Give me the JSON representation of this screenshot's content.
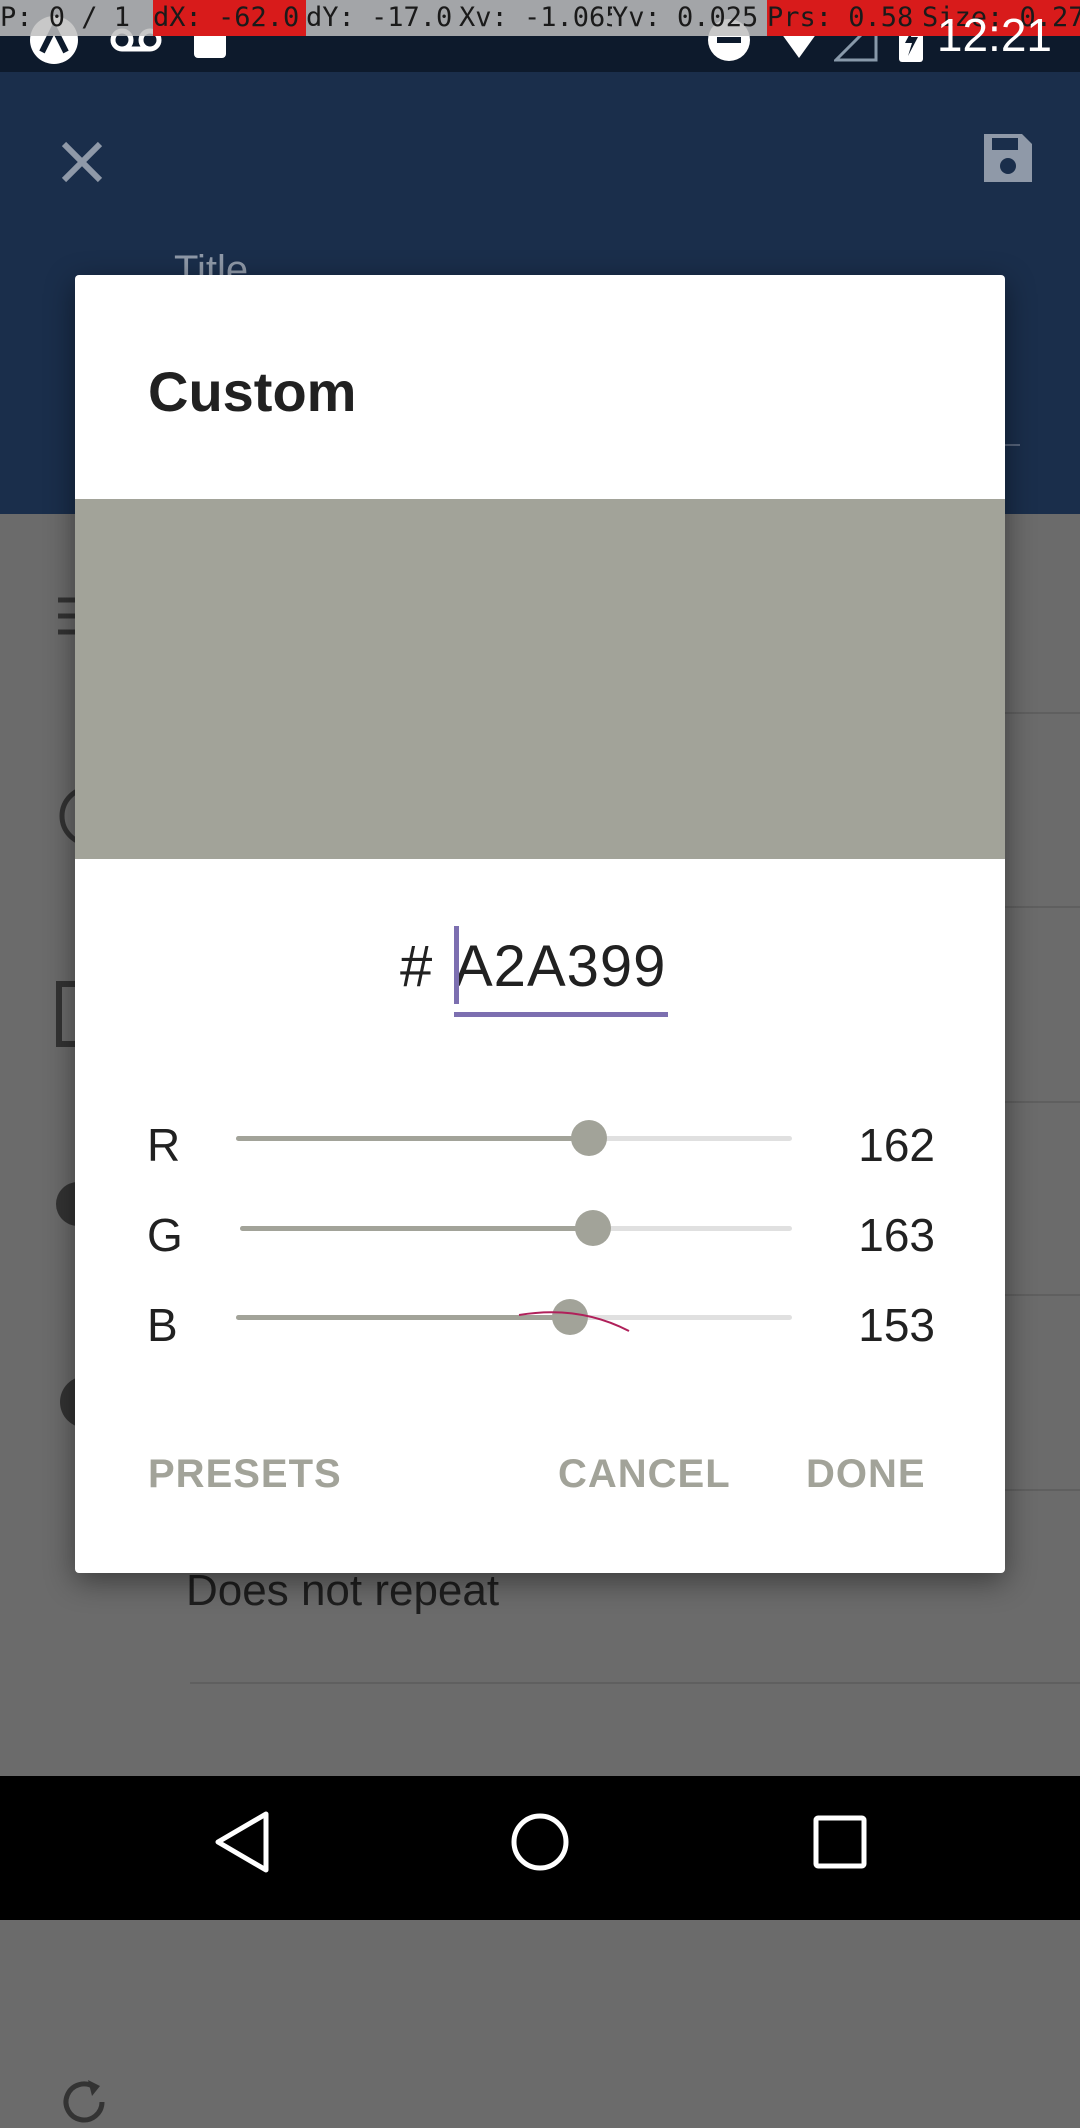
{
  "debug_bar": {
    "pointer": "P: 0 / 1",
    "dx": "dX: -62.0",
    "dy": "dY: -17.0",
    "xv": "Xv: -1.065",
    "yv": "Yv: 0.025",
    "prs": "Prs: 0.58",
    "size": "Size: 0.27"
  },
  "status_bar": {
    "time": "12:21"
  },
  "background": {
    "title_placeholder": "Title",
    "repeat_label": "Does not repeat"
  },
  "dialog": {
    "title": "Custom",
    "color_hex": "#A2A399",
    "hex_prefix": "#",
    "hex_value": "A2A399",
    "channels": [
      {
        "label": "R",
        "value": 162,
        "display": "162",
        "fraction": 0.635
      },
      {
        "label": "G",
        "value": 163,
        "display": "163",
        "fraction": 0.639
      },
      {
        "label": "B",
        "value": 153,
        "display": "153",
        "fraction": 0.6
      }
    ],
    "buttons": {
      "presets": "PRESETS",
      "cancel": "CANCEL",
      "done": "DONE"
    }
  },
  "colors": {
    "app_bar": "#1a2e4b",
    "status_bar": "#0d1a2c",
    "accent": "#7c6fb0",
    "slider": "#a2a399"
  }
}
